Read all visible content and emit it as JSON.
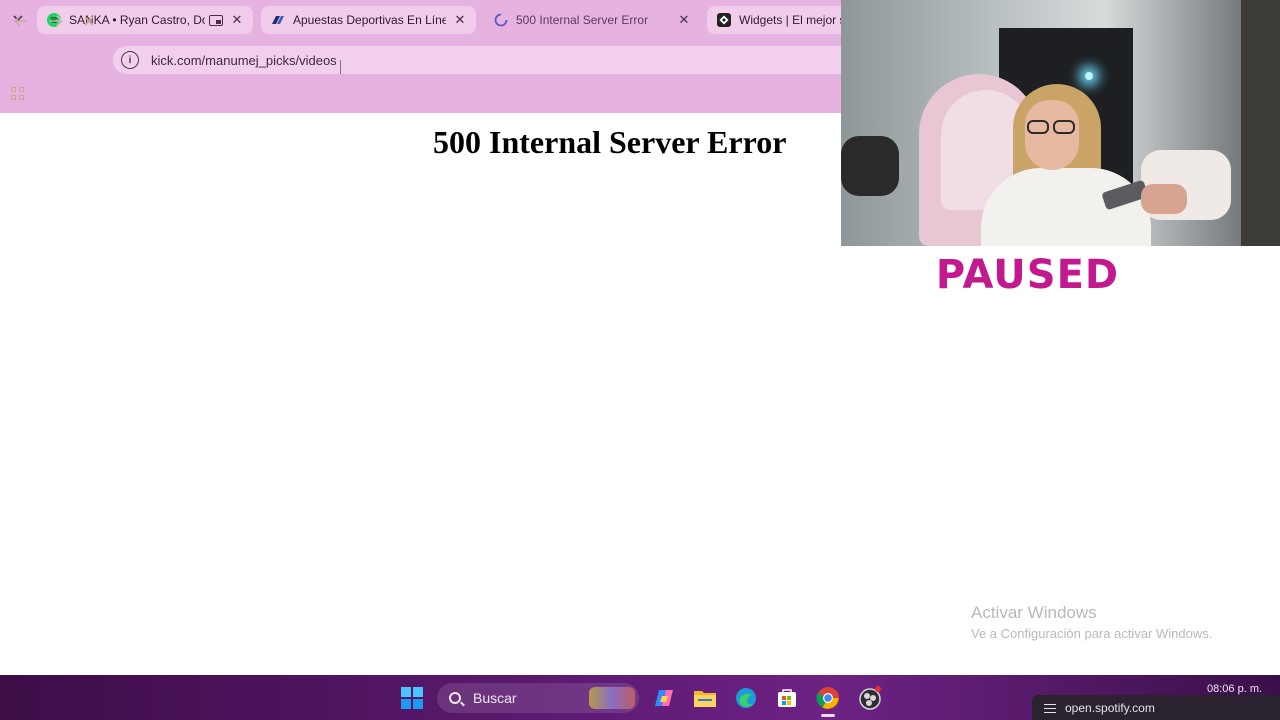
{
  "browser": {
    "tabs": [
      {
        "title": "SANKA • Ryan Castro, Dond",
        "favicon": "spotify-icon",
        "active": false
      },
      {
        "title": "Apuestas Deportivas En Línea |",
        "favicon": "betting-site-icon",
        "active": false
      },
      {
        "title": "500 Internal Server Error",
        "favicon": "loading-spinner-icon",
        "active": true
      },
      {
        "title": "Widgets | El mejor so",
        "favicon": "widgets-site-icon",
        "active": false
      }
    ],
    "tab_close_glyph": "✕",
    "address_bar": {
      "url": "kick.com/manumej_picks/videos"
    },
    "theme_color": "#e6b3e1"
  },
  "page": {
    "heading": "500 Internal Server Error"
  },
  "overlay": {
    "status_text": "PAUSED",
    "status_color": "#c2198f"
  },
  "watermark": {
    "title": "Activar Windows",
    "subtitle": "Ve a Configuración para activar Windows."
  },
  "taskbar": {
    "search_label": "Buscar",
    "clock": "08:06 p. m.",
    "notification_text": "open.spotify.com",
    "pinned_apps": [
      "windows-start-icon",
      "copilot-icon",
      "file-explorer-icon",
      "edge-icon",
      "microsoft-store-icon",
      "chrome-icon",
      "obs-icon"
    ]
  }
}
